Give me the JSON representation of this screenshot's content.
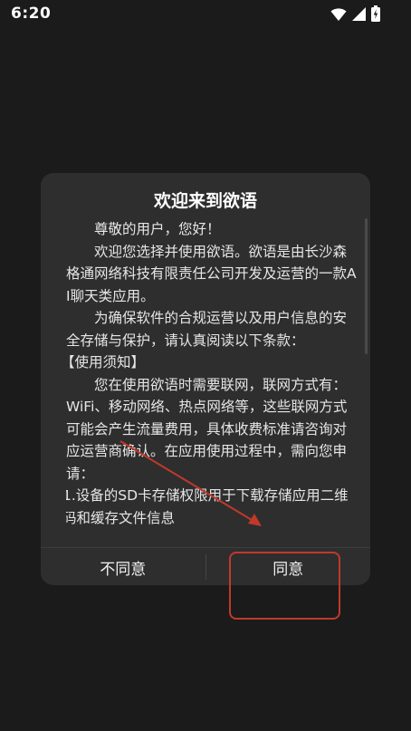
{
  "status_bar": {
    "time": "6:20",
    "icons": [
      "wifi-icon",
      "signal-icon",
      "battery-icon"
    ]
  },
  "dialog": {
    "title": "欢迎来到欲语",
    "paragraphs": [
      "尊敬的用户，您好！",
      "欢迎您选择并使用欲语。欲语是由长沙森格通网络科技有限责任公司开发及运营的一款AI聊天类应用。",
      "为确保软件的合规运营以及用户信息的安全存储与保护，请认真阅读以下条款：",
      "【使用须知】",
      "您在使用欲语时需要联网，联网方式有：WiFi、移动网络、热点网络等，这些联网方式可能会产生流量费用，具体收费标准请咨询对应运营商确认。在应用使用过程中，需向您申请：",
      "1.设备的SD卡存储权限用于下载存储应用二维码和缓存文件信息"
    ],
    "buttons": {
      "disagree": "不同意",
      "agree": "同意"
    }
  },
  "annotation": {
    "color": "#c0392b"
  }
}
